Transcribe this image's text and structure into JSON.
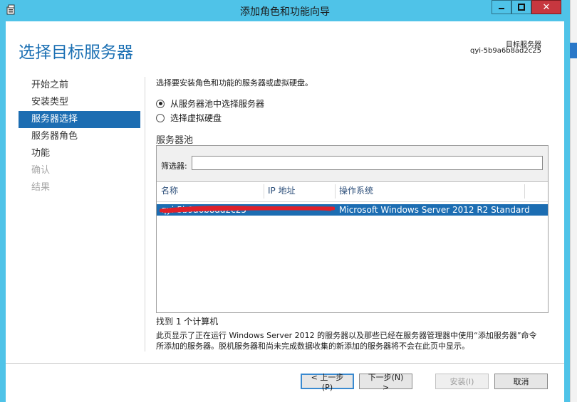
{
  "window": {
    "title": "添加角色和功能向导",
    "minimize_glyph": "▬",
    "maximize_glyph": "▢",
    "close_glyph": "✕"
  },
  "header": {
    "page_title": "选择目标服务器",
    "destination_label": "目标服务器",
    "destination_name": "qyi-5b9a6b8ad2c25"
  },
  "nav": {
    "items": [
      {
        "label": "开始之前",
        "state": "normal"
      },
      {
        "label": "安装类型",
        "state": "normal"
      },
      {
        "label": "服务器选择",
        "state": "active"
      },
      {
        "label": "服务器角色",
        "state": "normal"
      },
      {
        "label": "功能",
        "state": "normal"
      },
      {
        "label": "确认",
        "state": "disabled"
      },
      {
        "label": "结果",
        "state": "disabled"
      }
    ]
  },
  "content": {
    "intro": "选择要安装角色和功能的服务器或虚拟硬盘。",
    "options": [
      {
        "label": "从服务器池中选择服务器",
        "selected": true
      },
      {
        "label": "选择虚拟硬盘",
        "selected": false
      }
    ],
    "pool_heading": "服务器池",
    "filter_label": "筛选器:",
    "filter_value": "",
    "columns": [
      "名称",
      "IP 地址",
      "操作系统"
    ],
    "rows": [
      {
        "name": "qyi-5b9a6b8ad2c25",
        "ip": "",
        "os": "Microsoft Windows Server 2012 R2 Standard",
        "selected": true
      }
    ],
    "found": "找到 1 个计算机",
    "note": "此页显示了正在运行 Windows Server 2012 的服务器以及那些已经在服务器管理器中使用“添加服务器”命令所添加的服务器。脱机服务器和尚未完成数据收集的新添加的服务器将不会在此页中显示。"
  },
  "buttons": {
    "previous": "< 上一步(P)",
    "next": "下一步(N) >",
    "install": "安装(I)",
    "cancel": "取消"
  },
  "colors": {
    "titlebar": "#4fc3e8",
    "accent": "#1c6db2",
    "redaction": "#e0202a"
  }
}
